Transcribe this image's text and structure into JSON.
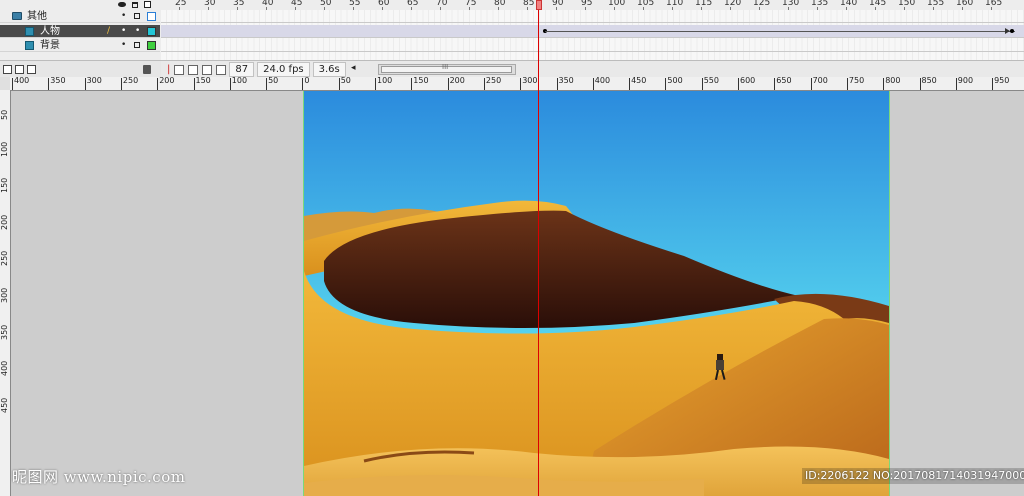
{
  "timeline": {
    "layers": [
      {
        "name": "其他",
        "color": "#2a7ed6",
        "selected": false
      },
      {
        "name": "人物",
        "color": "#23c6d6",
        "selected": true
      },
      {
        "name": "背景",
        "color": "#3fcf3f",
        "selected": false
      }
    ],
    "frame_numbers": [
      "25",
      "30",
      "35",
      "40",
      "45",
      "50",
      "55",
      "60",
      "65",
      "70",
      "75",
      "80",
      "85",
      "90",
      "95",
      "100",
      "105",
      "110",
      "115",
      "120",
      "125",
      "130",
      "135",
      "140",
      "145",
      "150",
      "155",
      "160",
      "165"
    ],
    "current_frame": "87",
    "frame_rate": "24.0 fps",
    "elapsed_time": "3.6s",
    "scroll_left_arrow": "◂",
    "scroll_grip": "III"
  },
  "rulers": {
    "horizontal": [
      "400",
      "350",
      "300",
      "250",
      "200",
      "150",
      "100",
      "50",
      "0",
      "50",
      "100",
      "150",
      "200",
      "250",
      "300",
      "350",
      "400",
      "450",
      "500",
      "550",
      "600",
      "650",
      "700",
      "750",
      "800",
      "850",
      "900",
      "950"
    ],
    "vertical": [
      "50",
      "100",
      "150",
      "200",
      "250",
      "300",
      "350",
      "400",
      "450"
    ]
  },
  "watermarks": {
    "left": "昵图网 www.nipic.com",
    "right": "ID:2206122 NO:20170817140319470000"
  },
  "colors": {
    "sky_top": "#2a8fde",
    "sky_bottom": "#5fe0f0",
    "dune_orange": "#e6a12c",
    "dune_shadow": "#3a1a10",
    "stage_border": "#7ad97a"
  }
}
